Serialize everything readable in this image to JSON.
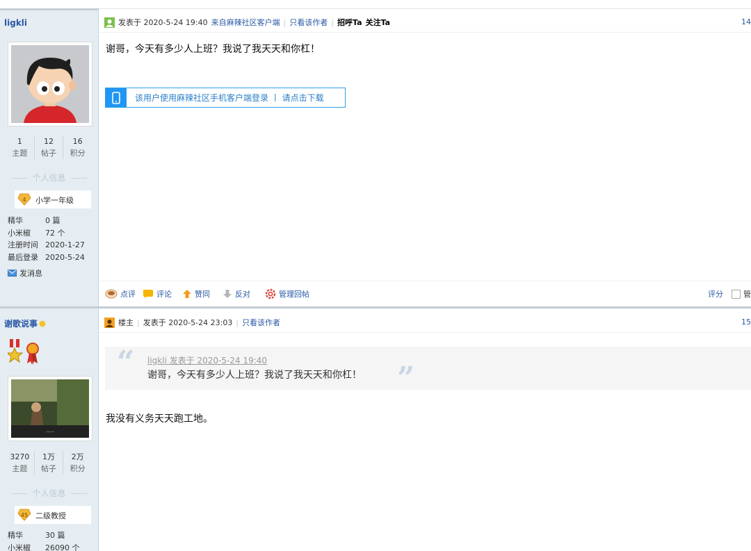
{
  "posts": [
    {
      "username": "ligkli",
      "stats": [
        {
          "value": "1",
          "label": "主题"
        },
        {
          "value": "12",
          "label": "帖子"
        },
        {
          "value": "16",
          "label": "积分"
        }
      ],
      "section_title": "个人信息",
      "level": {
        "number": "4",
        "title": "小学一年级"
      },
      "info": [
        {
          "key": "精华",
          "value": "0 篇"
        },
        {
          "key": "小米椒",
          "value": "72 个"
        },
        {
          "key": "注册时间",
          "value": "2020-1-27"
        },
        {
          "key": "最后登录",
          "value": "2020-5-24"
        }
      ],
      "send_message": "发消息",
      "header": {
        "posted": "发表于 2020-5-24 19:40",
        "client": "来自麻辣社区客户端",
        "only_author": "只看该作者",
        "greet": "招呼Ta",
        "follow": "关注Ta",
        "floor": "14"
      },
      "content": "谢哥，今天有多少人上班？我说了我天天和你杠！",
      "app_banner": "该用户使用麻辣社区手机客户端登录 丨 请点击下载",
      "actions": {
        "comment": "点评",
        "reply": "评论",
        "like": "赞同",
        "oppose": "反对",
        "manage": "管理回帖",
        "rate": "评分",
        "manage_short": "管"
      }
    },
    {
      "username": "谢歌说事",
      "stats": [
        {
          "value": "3270",
          "label": "主题"
        },
        {
          "value": "1万",
          "label": "帖子"
        },
        {
          "value": "2万",
          "label": "积分"
        }
      ],
      "section_title": "个人信息",
      "level": {
        "number": "45",
        "title": "二级教授"
      },
      "info": [
        {
          "key": "精华",
          "value": "30 篇"
        },
        {
          "key": "小米椒",
          "value": "26090 个"
        }
      ],
      "header": {
        "role": "楼主",
        "posted": "发表于 2020-5-24 23:03",
        "only_author": "只看该作者",
        "floor": "15"
      },
      "quote": {
        "author_line": "ligkli 发表于 2020-5-24 19:40",
        "text": "谢哥，今天有多少人上班？我说了我天天和你杠！"
      },
      "content": "我没有义务天天跑工地。"
    }
  ],
  "colors": {
    "link": "#2a58a5",
    "sidebar_bg": "#e5edf2",
    "accent_blue": "#2196f3"
  }
}
